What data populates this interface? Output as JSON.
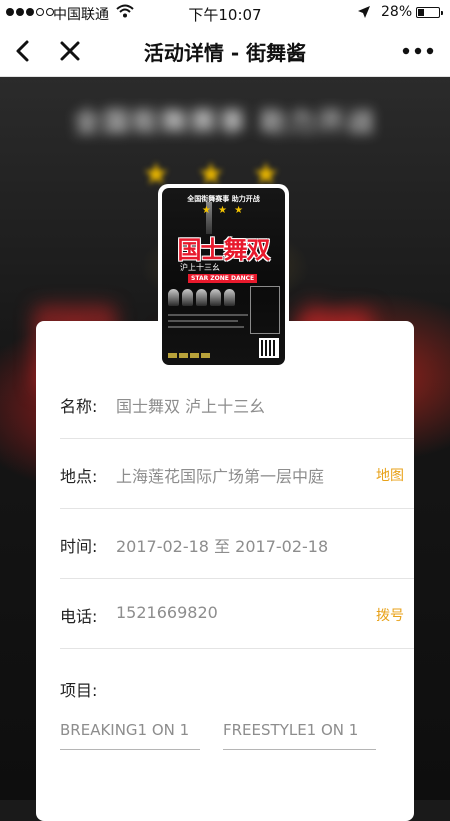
{
  "status_bar": {
    "carrier": "中国联通",
    "time": "下午10:07",
    "battery_percent_text": "28%",
    "battery_level": 0.28,
    "signal_strength": 3,
    "signal_max": 5
  },
  "nav": {
    "title": "活动详情 - 街舞酱",
    "back_icon": "chevron-left-icon",
    "close_icon": "close-icon",
    "more_icon": "more-horizontal-icon"
  },
  "poster": {
    "top_text": "全国街舞赛事  助力开战",
    "title": "国士舞双",
    "subtitle": "沪上十三幺",
    "english": "STAR ZONE DANCE"
  },
  "details": {
    "name": {
      "label": "名称:",
      "value": "国士舞双 泸上十三幺"
    },
    "location": {
      "label": "地点:",
      "value": "上海莲花国际广场第一层中庭",
      "action": "地图"
    },
    "time": {
      "label": "时间:",
      "value": "2017-02-18 至 2017-02-18"
    },
    "phone": {
      "label": "电话:",
      "value": "1521669820",
      "action": "拨号"
    },
    "items": {
      "label": "项目:",
      "tags": [
        "BREAKING1 ON 1",
        "FREESTYLE1 ON 1"
      ]
    }
  },
  "colors": {
    "accent": "#e8a21a",
    "label_text": "#222222",
    "value_text": "#8d8d8d",
    "poster_red": "#e8192c",
    "poster_gold": "#f2c200"
  }
}
